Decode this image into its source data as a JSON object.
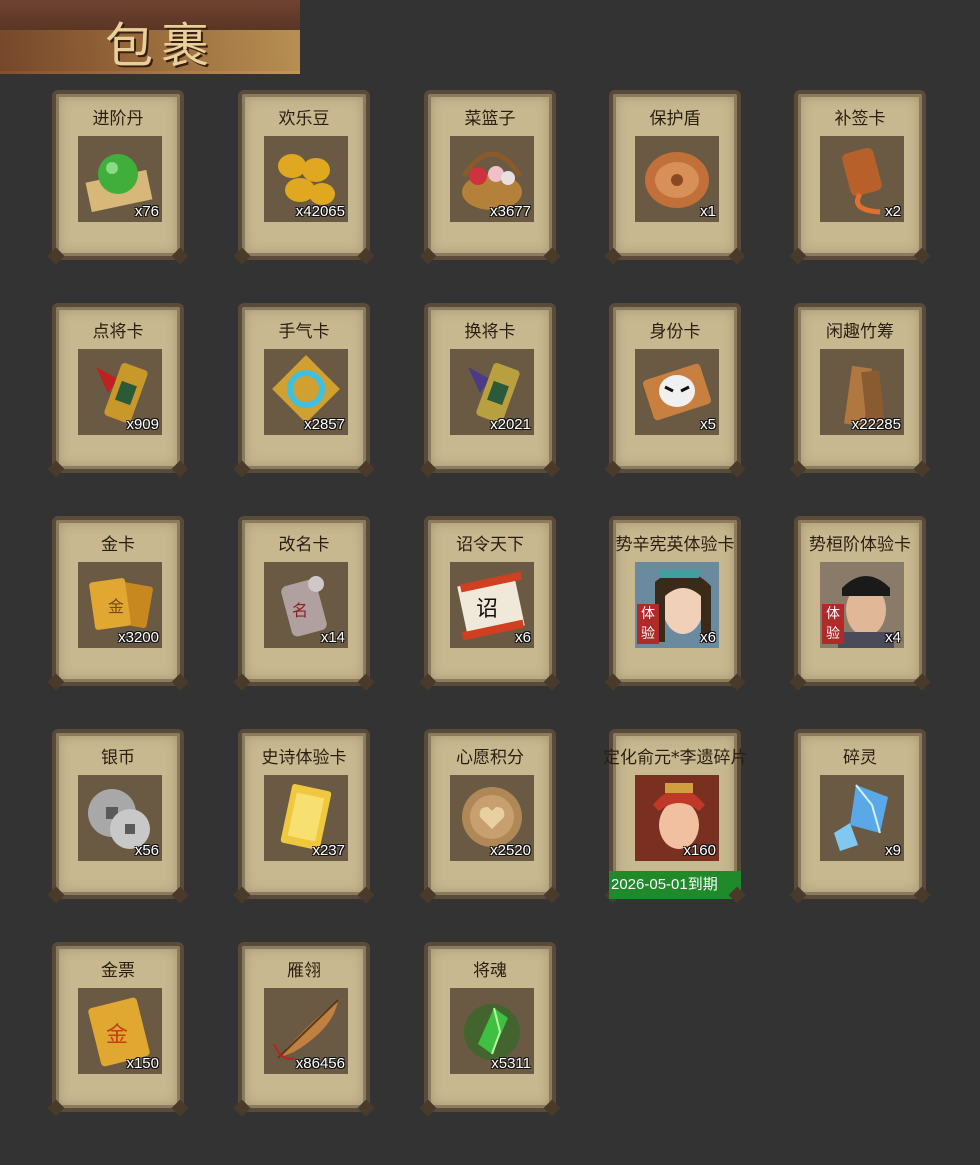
{
  "header": {
    "title": "包裹"
  },
  "items": [
    {
      "name": "进阶丹",
      "qty": "x76",
      "icon": "green-orb-icon",
      "color": "#3fae3a"
    },
    {
      "name": "欢乐豆",
      "qty": "x42065",
      "icon": "gold-beans-icon",
      "color": "#e0a820"
    },
    {
      "name": "菜篮子",
      "qty": "x3677",
      "icon": "flower-basket-icon",
      "color": "#b5803a"
    },
    {
      "name": "保护盾",
      "qty": "x1",
      "icon": "shield-icon",
      "color": "#c07038"
    },
    {
      "name": "补签卡",
      "qty": "x2",
      "icon": "tag-card-icon",
      "color": "#b8602a"
    },
    {
      "name": "点将卡",
      "qty": "x909",
      "icon": "general-card-icon",
      "color": "#c8982a"
    },
    {
      "name": "手气卡",
      "qty": "x2857",
      "icon": "luck-card-icon",
      "color": "#d0a030"
    },
    {
      "name": "换将卡",
      "qty": "x2021",
      "icon": "swap-card-icon",
      "color": "#b8a040"
    },
    {
      "name": "身份卡",
      "qty": "x5",
      "icon": "mask-card-icon",
      "color": "#c88040"
    },
    {
      "name": "闲趣竹筹",
      "qty": "x22285",
      "icon": "bamboo-tally-icon",
      "color": "#b07840"
    },
    {
      "name": "金卡",
      "qty": "x3200",
      "icon": "gold-card-icon",
      "color": "#e0a830"
    },
    {
      "name": "改名卡",
      "qty": "x14",
      "icon": "rename-card-icon",
      "color": "#b0a0a0"
    },
    {
      "name": "诏令天下",
      "qty": "x6",
      "icon": "scroll-edict-icon",
      "color": "#d04020"
    },
    {
      "name": "势辛宪英体验卡",
      "qty": "x6",
      "icon": "heroine-portrait-icon",
      "color": "#c8a890",
      "badge": "体验"
    },
    {
      "name": "势桓阶体验卡",
      "qty": "x4",
      "icon": "hero-portrait-icon",
      "color": "#8a7060",
      "badge": "体验"
    },
    {
      "name": "银币",
      "qty": "x56",
      "icon": "silver-coin-icon",
      "color": "#a8a8a8"
    },
    {
      "name": "史诗体验卡",
      "qty": "x237",
      "icon": "epic-card-icon",
      "color": "#f0c840"
    },
    {
      "name": "心愿积分",
      "qty": "x2520",
      "icon": "heart-coin-icon",
      "color": "#b08858"
    },
    {
      "name": "定化俞元*李遗碎片",
      "qty": "x160",
      "icon": "warrior-portrait-icon",
      "color": "#c03828",
      "expiry": "2026-05-01到期"
    },
    {
      "name": "碎灵",
      "qty": "x9",
      "icon": "crystal-shard-icon",
      "color": "#5aa8e8"
    },
    {
      "name": "金票",
      "qty": "x150",
      "icon": "gold-ticket-icon",
      "color": "#e0a830"
    },
    {
      "name": "雁翎",
      "qty": "x86456",
      "icon": "feather-icon",
      "color": "#c08040"
    },
    {
      "name": "将魂",
      "qty": "x5311",
      "icon": "green-soul-icon",
      "color": "#40c040"
    }
  ]
}
